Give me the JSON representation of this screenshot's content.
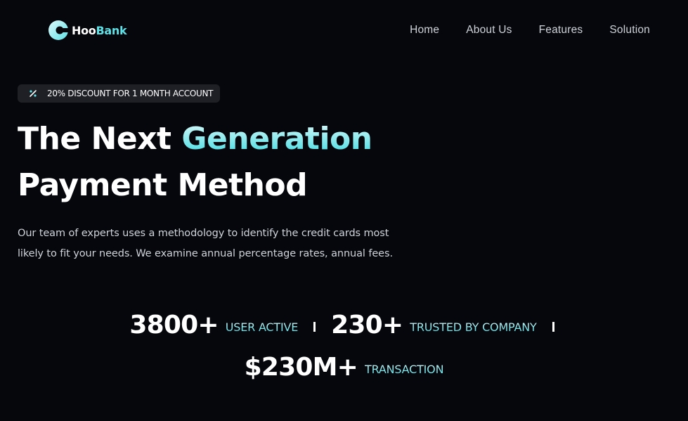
{
  "brand": {
    "name_prefix": "Hoo",
    "name_suffix": "Bank",
    "accent_color": "#5ce1e6"
  },
  "nav": {
    "items": [
      {
        "label": "Home"
      },
      {
        "label": "About Us"
      },
      {
        "label": "Features"
      },
      {
        "label": "Solution"
      }
    ]
  },
  "hero": {
    "badge": {
      "icon": "discount-icon",
      "text": "20% DISCOUNT FOR 1 MONTH ACCOUNT"
    },
    "title_line1_plain": "The Next",
    "title_line1_accent": "Generation",
    "title_line2": "Payment Method",
    "description": "Our team of experts uses a methodology to identify the credit cards most likely to fit your needs. We examine annual percentage rates, annual fees."
  },
  "stats": [
    {
      "value": "3800+",
      "label": "USER ACTIVE"
    },
    {
      "value": "230+",
      "label": "TRUSTED BY COMPANY"
    },
    {
      "value": "$230M+",
      "label": "TRANSACTION"
    }
  ],
  "colors": {
    "background": "#06070c",
    "text_muted": "#cfd3da",
    "badge_bg": "#1f2026"
  }
}
